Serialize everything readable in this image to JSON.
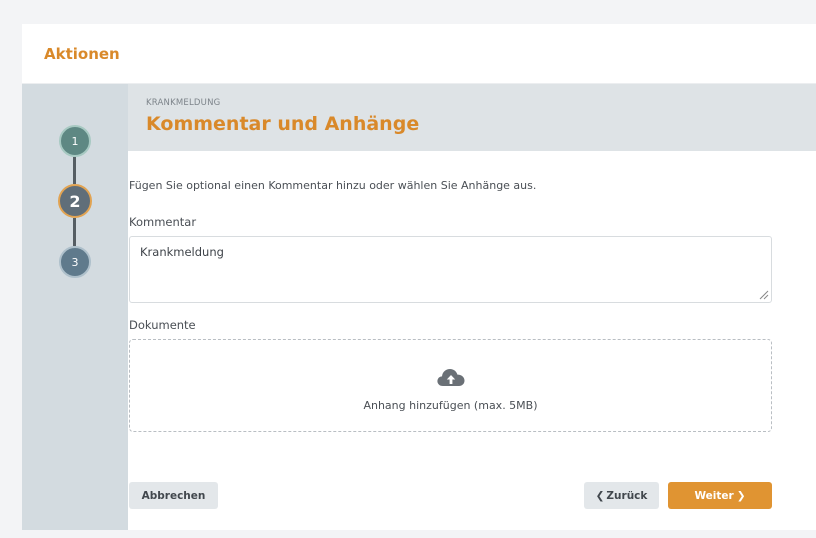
{
  "header": {
    "title": "Aktionen"
  },
  "stepper": {
    "steps": [
      {
        "label": "1"
      },
      {
        "label": "2"
      },
      {
        "label": "3"
      }
    ]
  },
  "form": {
    "section": "KRANKMELDUNG",
    "heading": "Kommentar und Anhänge",
    "intro": "Fügen Sie optional einen Kommentar hinzu oder wählen Sie Anhänge aus.",
    "comment_label": "Kommentar",
    "comment_value": "Krankmeldung",
    "documents_label": "Dokumente",
    "dropzone_text": "Anhang hinzufügen (max. 5MB)",
    "dropzone_icon": "cloud-upload-icon"
  },
  "buttons": {
    "cancel": "Abbrechen",
    "back": "Zurück",
    "next": "Weiter"
  },
  "colors": {
    "accent": "#d9892a",
    "primary_button": "#e09432",
    "stepper_bg": "#d3dbe0"
  }
}
